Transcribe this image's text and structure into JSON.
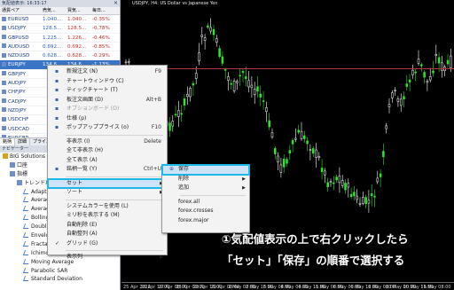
{
  "market_watch": {
    "title": "気配値表示: 16:33:17",
    "close": "×",
    "columns": [
      "通貨ペア",
      "売気...",
      "買気...",
      "毎日..."
    ],
    "rows": [
      {
        "symbol": "EURUSD",
        "bid": "1.040...",
        "ask": "1.040...",
        "change": "-0.35%"
      },
      {
        "symbol": "USDJPY",
        "bid": "128.5...",
        "ask": "128.5...",
        "change": "-0.78%"
      },
      {
        "symbol": "GBPUSD",
        "bid": "1.225...",
        "ask": "1.226...",
        "change": "-0.46%"
      },
      {
        "symbol": "AUDUSD",
        "bid": "0.692...",
        "ask": "0.692...",
        "change": "-0.85%"
      },
      {
        "symbol": "NZDUSD",
        "bid": "0.628...",
        "ask": "0.628...",
        "change": "-0.29%"
      },
      {
        "symbol": "EURJPY",
        "bid": "134.6...",
        "ask": "134.6...",
        "change": "-1.13%"
      },
      {
        "symbol": "GBPJPY",
        "bid": "",
        "ask": "",
        "change": ""
      },
      {
        "symbol": "AUDJPY",
        "bid": "",
        "ask": "",
        "change": ""
      },
      {
        "symbol": "CHFJPY",
        "bid": "",
        "ask": "",
        "change": ""
      },
      {
        "symbol": "CADJPY",
        "bid": "",
        "ask": "",
        "change": ""
      },
      {
        "symbol": "NZDJPY",
        "bid": "",
        "ask": "",
        "change": ""
      },
      {
        "symbol": "USDCHF",
        "bid": "",
        "ask": "",
        "change": ""
      },
      {
        "symbol": "USDCAD",
        "bid": "",
        "ask": "",
        "change": ""
      },
      {
        "symbol": "EURGBP",
        "bid": "",
        "ask": "",
        "change": ""
      }
    ],
    "tabs": [
      "銘柄",
      "詳細",
      "プライスボード"
    ]
  },
  "navigator": {
    "title": "ナビゲーター",
    "items": [
      {
        "label": "BIG Solutions MT5",
        "indent": 0
      },
      {
        "label": "口座",
        "indent": 1
      },
      {
        "label": "指標",
        "indent": 1
      },
      {
        "label": "トレンド系",
        "indent": 2
      },
      {
        "label": "Adaptive M",
        "indent": 3
      },
      {
        "label": "Average Di",
        "indent": 3
      },
      {
        "label": "Average D",
        "indent": 3
      },
      {
        "label": "Bollinger B",
        "indent": 3
      },
      {
        "label": "Double Exp",
        "indent": 3
      },
      {
        "label": "Envelopes",
        "indent": 3
      },
      {
        "label": "Fractal Ada",
        "indent": 3
      },
      {
        "label": "Ichimoku K",
        "indent": 3
      },
      {
        "label": "Moving Average",
        "indent": 3
      },
      {
        "label": "Parabolic SAR",
        "indent": 3
      },
      {
        "label": "Standard Deviation",
        "indent": 3
      }
    ]
  },
  "chart": {
    "title": "USDJPY, H4: US Dollar vs Japanese Yen",
    "x_ticks": [
      "25 Apr 2022",
      "26 Apr 16:00",
      "27 Apr 08:00",
      "28 Apr 00:00",
      "28 Apr 16:00",
      "29 Apr 08:00",
      "2 May 00:00",
      "2 May 16:00",
      "3 May 08:00",
      "4 May 00:00",
      "4 May 16:00",
      "5 May 08:00",
      "6 May 00:00",
      "6 May 16:00",
      "9 May 08:00",
      "10 May 00:00",
      "10 May 16:00",
      "11 May 08:00"
    ]
  },
  "context_menu": {
    "items": [
      {
        "label": "新規注文 (N)",
        "shortcut": "F9",
        "icon": "new-order-icon",
        "type": "item"
      },
      {
        "label": "チャートウィンドウ (C)",
        "shortcut": "",
        "icon": "chart-window-icon",
        "type": "item"
      },
      {
        "label": "ティックチャート (T)",
        "shortcut": "",
        "icon": "tick-chart-icon",
        "type": "item"
      },
      {
        "label": "板注文画面 (D)",
        "shortcut": "Alt+B",
        "icon": "depth-of-market-icon",
        "type": "item"
      },
      {
        "label": "オプションボード (O)",
        "shortcut": "",
        "icon": "option-board-icon",
        "type": "disabled"
      },
      {
        "label": "仕様 (p)",
        "shortcut": "",
        "icon": "specification-icon",
        "type": "item"
      },
      {
        "label": "ポップアッププライス (o)",
        "shortcut": "F10",
        "icon": "popup-prices-icon",
        "type": "item"
      },
      {
        "type": "sep"
      },
      {
        "label": "非表示 (I)",
        "shortcut": "Delete",
        "icon": "",
        "type": "item"
      },
      {
        "label": "全て非表示 (H)",
        "shortcut": "",
        "icon": "",
        "type": "item"
      },
      {
        "label": "全て表示 (A)",
        "shortcut": "",
        "icon": "",
        "type": "item"
      },
      {
        "label": "銘柄一覧 (Y)",
        "shortcut": "Ctrl+U",
        "icon": "symbols-list-icon",
        "type": "item"
      },
      {
        "type": "sep"
      },
      {
        "label": "セット",
        "shortcut": "",
        "icon": "",
        "type": "submenu-hl"
      },
      {
        "label": "ソート",
        "shortcut": "",
        "icon": "",
        "type": "submenu"
      },
      {
        "type": "sep"
      },
      {
        "label": "システムカラーを使用 (L)",
        "shortcut": "",
        "icon": "",
        "type": "item"
      },
      {
        "label": "ミリ秒を表示する (M)",
        "shortcut": "",
        "icon": "",
        "type": "item"
      },
      {
        "label": "自動削除 (E)",
        "shortcut": "",
        "icon": "",
        "type": "item"
      },
      {
        "label": "自動整列 (A)",
        "shortcut": "",
        "icon": "",
        "type": "item"
      },
      {
        "label": "グリッド (G)",
        "shortcut": "",
        "icon": "",
        "type": "check"
      },
      {
        "type": "sep"
      },
      {
        "label": "表示列",
        "shortcut": "",
        "icon": "",
        "type": "submenu"
      }
    ]
  },
  "submenu": {
    "items": [
      {
        "label": "保存",
        "type": "hl",
        "icon": "save-icon"
      },
      {
        "label": "削除",
        "type": "submenu",
        "icon": ""
      },
      {
        "label": "追加",
        "type": "submenu",
        "icon": ""
      },
      {
        "type": "sep"
      },
      {
        "label": "forex.all",
        "type": "item",
        "icon": ""
      },
      {
        "label": "forex.crosses",
        "type": "item",
        "icon": ""
      },
      {
        "label": "forex.major",
        "type": "item",
        "icon": ""
      }
    ]
  },
  "annotation": {
    "line1": "①気配値表示の上で右クリックしたら",
    "line2": "「セット」「保存」の順番で選択する"
  },
  "colors": {
    "selected_row": "#3a74c5",
    "highlight_outline": "#1fb8e6",
    "candle_bull": "#2ee62e",
    "candle_bear": "#ffffff",
    "price_line": "#b0373a"
  }
}
